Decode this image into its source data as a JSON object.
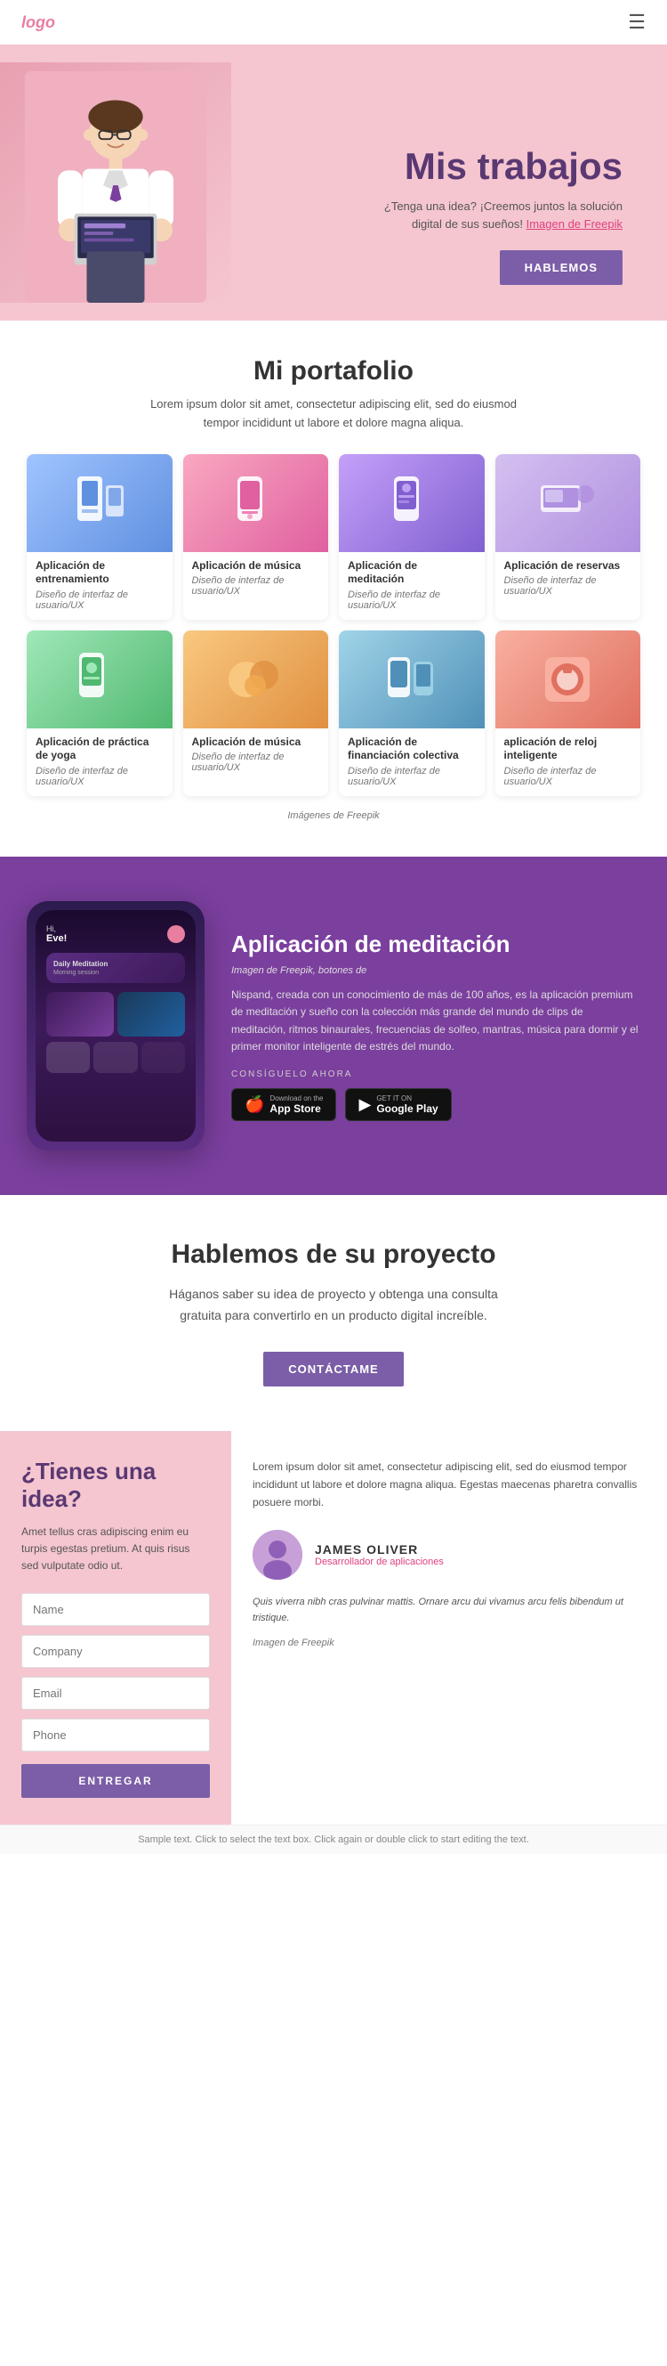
{
  "header": {
    "logo": "logo",
    "menu_icon": "☰"
  },
  "hero": {
    "title": "Mis trabajos",
    "subtitle_line1": "¿Tenga una idea? ¡Creemos juntos la solución",
    "subtitle_line2": "digital de sus sueños!",
    "subtitle_image": "Imagen de Freepik",
    "button": "HABLEMOS"
  },
  "portfolio": {
    "title": "Mi portafolio",
    "description": "Lorem ipsum dolor sit amet, consectetur adipiscing elit, sed do eiusmod tempor incididunt ut labore et dolore magna aliqua.",
    "items": [
      {
        "title": "Aplicación de entrenamiento",
        "sub": "Diseño de interfaz de usuario/UX"
      },
      {
        "title": "Aplicación de música",
        "sub": "Diseño de interfaz de usuario/UX"
      },
      {
        "title": "Aplicación de meditación",
        "sub": "Diseño de interfaz de usuario/UX"
      },
      {
        "title": "Aplicación de reservas",
        "sub": "Diseño de interfaz de usuario/UX"
      },
      {
        "title": "Aplicación de práctica de yoga",
        "sub": "Diseño de interfaz de usuario/UX"
      },
      {
        "title": "Aplicación de música",
        "sub": "Diseño de interfaz de usuario/UX"
      },
      {
        "title": "Aplicación de financiación colectiva",
        "sub": "Diseño de interfaz de usuario/UX"
      },
      {
        "title": "aplicación de reloj inteligente",
        "sub": "Diseño de interfaz de usuario/UX"
      }
    ],
    "credit": "Imágenes de Freepik"
  },
  "meditation": {
    "title": "Aplicación de meditación",
    "credit": "Imagen de Freepik, botones de",
    "description": "Nispand, creada con un conocimiento de más de 100 años, es la aplicación premium de meditación y sueño con la colección más grande del mundo de clips de meditación, ritmos binaurales, frecuencias de solfeo, mantras, música para dormir y el primer monitor inteligente de estrés del mundo.",
    "consiguelo": "CONSÍGUELO AHORA",
    "app_store": "App Store",
    "google_play": "Google Play",
    "download_on": "Download on the",
    "get_it_on": "GET IT ON",
    "mockup": {
      "greeting": "Hi, Eve!",
      "dot": ""
    }
  },
  "project": {
    "title": "Hablemos de su proyecto",
    "description": "Háganos saber su idea de proyecto y obtenga una consulta gratuita para convertirlo en un producto digital increíble.",
    "button": "CONTÁCTAME"
  },
  "bottom": {
    "left": {
      "title": "¿Tienes una idea?",
      "description": "Amet tellus cras adipiscing enim eu turpis egestas pretium. At quis risus sed vulputate odio ut.",
      "name_placeholder": "Name",
      "company_placeholder": "Company",
      "email_placeholder": "Email",
      "phone_placeholder": "Phone",
      "submit": "ENTREGAR"
    },
    "right": {
      "description": "Lorem ipsum dolor sit amet, consectetur adipiscing elit, sed do eiusmod tempor incididunt ut labore et dolore magna aliqua. Egestas maecenas pharetra convallis posuere morbi.",
      "author_name": "JAMES OLIVER",
      "author_title": "Desarrollador de aplicaciones",
      "quote": "Quis viverra nibh cras pulvinar mattis. Ornare arcu dui vivamus arcu felis bibendum ut tristique.",
      "img_credit": "Imagen de Freepik"
    }
  },
  "footer": {
    "text": "Sample text. Click to select the text box. Click again or double click to start editing the text."
  }
}
